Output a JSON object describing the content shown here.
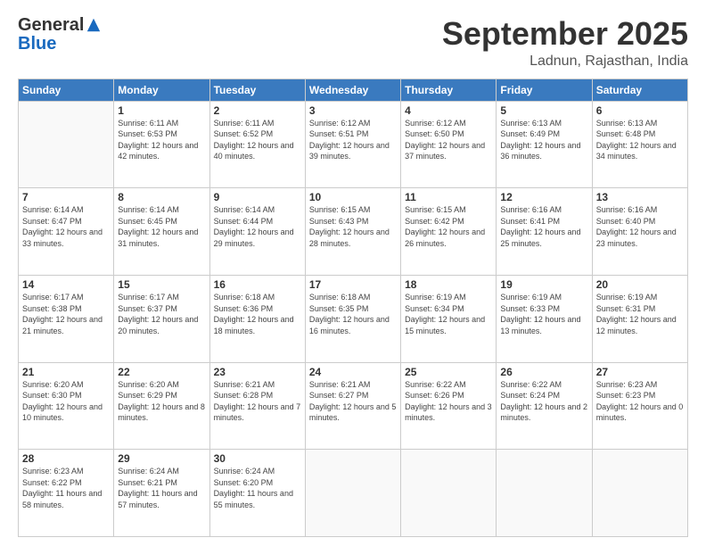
{
  "logo": {
    "general": "General",
    "blue": "Blue"
  },
  "header": {
    "month": "September 2025",
    "location": "Ladnun, Rajasthan, India"
  },
  "days_of_week": [
    "Sunday",
    "Monday",
    "Tuesday",
    "Wednesday",
    "Thursday",
    "Friday",
    "Saturday"
  ],
  "weeks": [
    [
      {
        "day": "",
        "sunrise": "",
        "sunset": "",
        "daylight": ""
      },
      {
        "day": "1",
        "sunrise": "Sunrise: 6:11 AM",
        "sunset": "Sunset: 6:53 PM",
        "daylight": "Daylight: 12 hours and 42 minutes."
      },
      {
        "day": "2",
        "sunrise": "Sunrise: 6:11 AM",
        "sunset": "Sunset: 6:52 PM",
        "daylight": "Daylight: 12 hours and 40 minutes."
      },
      {
        "day": "3",
        "sunrise": "Sunrise: 6:12 AM",
        "sunset": "Sunset: 6:51 PM",
        "daylight": "Daylight: 12 hours and 39 minutes."
      },
      {
        "day": "4",
        "sunrise": "Sunrise: 6:12 AM",
        "sunset": "Sunset: 6:50 PM",
        "daylight": "Daylight: 12 hours and 37 minutes."
      },
      {
        "day": "5",
        "sunrise": "Sunrise: 6:13 AM",
        "sunset": "Sunset: 6:49 PM",
        "daylight": "Daylight: 12 hours and 36 minutes."
      },
      {
        "day": "6",
        "sunrise": "Sunrise: 6:13 AM",
        "sunset": "Sunset: 6:48 PM",
        "daylight": "Daylight: 12 hours and 34 minutes."
      }
    ],
    [
      {
        "day": "7",
        "sunrise": "Sunrise: 6:14 AM",
        "sunset": "Sunset: 6:47 PM",
        "daylight": "Daylight: 12 hours and 33 minutes."
      },
      {
        "day": "8",
        "sunrise": "Sunrise: 6:14 AM",
        "sunset": "Sunset: 6:45 PM",
        "daylight": "Daylight: 12 hours and 31 minutes."
      },
      {
        "day": "9",
        "sunrise": "Sunrise: 6:14 AM",
        "sunset": "Sunset: 6:44 PM",
        "daylight": "Daylight: 12 hours and 29 minutes."
      },
      {
        "day": "10",
        "sunrise": "Sunrise: 6:15 AM",
        "sunset": "Sunset: 6:43 PM",
        "daylight": "Daylight: 12 hours and 28 minutes."
      },
      {
        "day": "11",
        "sunrise": "Sunrise: 6:15 AM",
        "sunset": "Sunset: 6:42 PM",
        "daylight": "Daylight: 12 hours and 26 minutes."
      },
      {
        "day": "12",
        "sunrise": "Sunrise: 6:16 AM",
        "sunset": "Sunset: 6:41 PM",
        "daylight": "Daylight: 12 hours and 25 minutes."
      },
      {
        "day": "13",
        "sunrise": "Sunrise: 6:16 AM",
        "sunset": "Sunset: 6:40 PM",
        "daylight": "Daylight: 12 hours and 23 minutes."
      }
    ],
    [
      {
        "day": "14",
        "sunrise": "Sunrise: 6:17 AM",
        "sunset": "Sunset: 6:38 PM",
        "daylight": "Daylight: 12 hours and 21 minutes."
      },
      {
        "day": "15",
        "sunrise": "Sunrise: 6:17 AM",
        "sunset": "Sunset: 6:37 PM",
        "daylight": "Daylight: 12 hours and 20 minutes."
      },
      {
        "day": "16",
        "sunrise": "Sunrise: 6:18 AM",
        "sunset": "Sunset: 6:36 PM",
        "daylight": "Daylight: 12 hours and 18 minutes."
      },
      {
        "day": "17",
        "sunrise": "Sunrise: 6:18 AM",
        "sunset": "Sunset: 6:35 PM",
        "daylight": "Daylight: 12 hours and 16 minutes."
      },
      {
        "day": "18",
        "sunrise": "Sunrise: 6:19 AM",
        "sunset": "Sunset: 6:34 PM",
        "daylight": "Daylight: 12 hours and 15 minutes."
      },
      {
        "day": "19",
        "sunrise": "Sunrise: 6:19 AM",
        "sunset": "Sunset: 6:33 PM",
        "daylight": "Daylight: 12 hours and 13 minutes."
      },
      {
        "day": "20",
        "sunrise": "Sunrise: 6:19 AM",
        "sunset": "Sunset: 6:31 PM",
        "daylight": "Daylight: 12 hours and 12 minutes."
      }
    ],
    [
      {
        "day": "21",
        "sunrise": "Sunrise: 6:20 AM",
        "sunset": "Sunset: 6:30 PM",
        "daylight": "Daylight: 12 hours and 10 minutes."
      },
      {
        "day": "22",
        "sunrise": "Sunrise: 6:20 AM",
        "sunset": "Sunset: 6:29 PM",
        "daylight": "Daylight: 12 hours and 8 minutes."
      },
      {
        "day": "23",
        "sunrise": "Sunrise: 6:21 AM",
        "sunset": "Sunset: 6:28 PM",
        "daylight": "Daylight: 12 hours and 7 minutes."
      },
      {
        "day": "24",
        "sunrise": "Sunrise: 6:21 AM",
        "sunset": "Sunset: 6:27 PM",
        "daylight": "Daylight: 12 hours and 5 minutes."
      },
      {
        "day": "25",
        "sunrise": "Sunrise: 6:22 AM",
        "sunset": "Sunset: 6:26 PM",
        "daylight": "Daylight: 12 hours and 3 minutes."
      },
      {
        "day": "26",
        "sunrise": "Sunrise: 6:22 AM",
        "sunset": "Sunset: 6:24 PM",
        "daylight": "Daylight: 12 hours and 2 minutes."
      },
      {
        "day": "27",
        "sunrise": "Sunrise: 6:23 AM",
        "sunset": "Sunset: 6:23 PM",
        "daylight": "Daylight: 12 hours and 0 minutes."
      }
    ],
    [
      {
        "day": "28",
        "sunrise": "Sunrise: 6:23 AM",
        "sunset": "Sunset: 6:22 PM",
        "daylight": "Daylight: 11 hours and 58 minutes."
      },
      {
        "day": "29",
        "sunrise": "Sunrise: 6:24 AM",
        "sunset": "Sunset: 6:21 PM",
        "daylight": "Daylight: 11 hours and 57 minutes."
      },
      {
        "day": "30",
        "sunrise": "Sunrise: 6:24 AM",
        "sunset": "Sunset: 6:20 PM",
        "daylight": "Daylight: 11 hours and 55 minutes."
      },
      {
        "day": "",
        "sunrise": "",
        "sunset": "",
        "daylight": ""
      },
      {
        "day": "",
        "sunrise": "",
        "sunset": "",
        "daylight": ""
      },
      {
        "day": "",
        "sunrise": "",
        "sunset": "",
        "daylight": ""
      },
      {
        "day": "",
        "sunrise": "",
        "sunset": "",
        "daylight": ""
      }
    ]
  ]
}
